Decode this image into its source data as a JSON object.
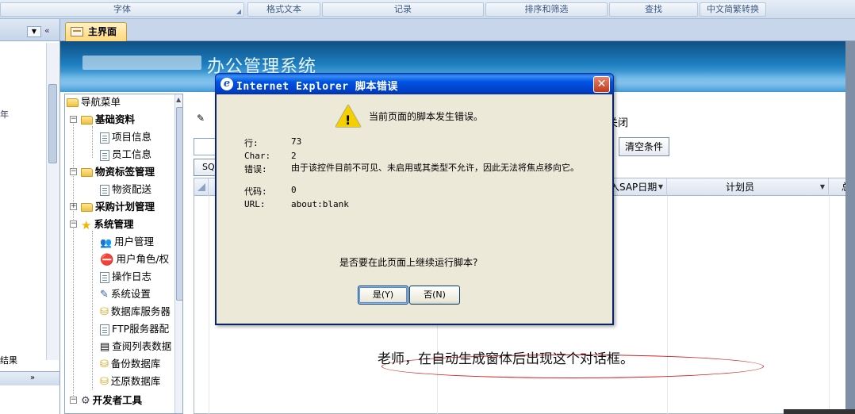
{
  "ribbon": {
    "groups": [
      "字体",
      "格式文本",
      "记录",
      "排序和筛选",
      "查找",
      "中文简繁转换"
    ]
  },
  "nav_pane": {
    "edge_text": "年",
    "result_text": "结果",
    "bottom_chevron": "»"
  },
  "tab": {
    "label": "主界面"
  },
  "banner": {
    "title": "办公管理系统"
  },
  "tree": {
    "nodes": [
      {
        "label": "导航菜单"
      },
      {
        "label": "基础资料"
      },
      {
        "label": "项目信息"
      },
      {
        "label": "员工信息"
      },
      {
        "label": "物资标签管理"
      },
      {
        "label": "物资配送"
      },
      {
        "label": "采购计划管理"
      },
      {
        "label": "系统管理"
      },
      {
        "label": "用户管理"
      },
      {
        "label": "用户角色/权"
      },
      {
        "label": "操作日志"
      },
      {
        "label": "系统设置"
      },
      {
        "label": "数据库服务器"
      },
      {
        "label": "FTP服务器配"
      },
      {
        "label": "查阅列表数据"
      },
      {
        "label": "备份数据库"
      },
      {
        "label": "还原数据库"
      },
      {
        "label": "开发者工具"
      }
    ]
  },
  "form": {
    "close_label": "关闭",
    "clear_label": "清空条件",
    "sq_label": "SQ",
    "columns": [
      "入SAP日期",
      "计划员",
      "总"
    ]
  },
  "annotation": "老师，在自动生成窗体后出现这个对话框。",
  "dialog": {
    "title": "Internet Explorer 脚本错误",
    "heading": "当前页面的脚本发生错误。",
    "fields": [
      {
        "label": "行:",
        "value": "73"
      },
      {
        "label": "Char:",
        "value": "2"
      },
      {
        "label": "错误:",
        "value": "由于该控件目前不可见、未启用或其类型不允许，因此无法将焦点移向它。"
      },
      {
        "label": "代码:",
        "value": "0"
      },
      {
        "label": "URL:",
        "value": "about:blank"
      }
    ],
    "question": "是否要在此页面上继续运行脚本?",
    "yes_label": "是(Y)",
    "no_label": "否(N)"
  }
}
